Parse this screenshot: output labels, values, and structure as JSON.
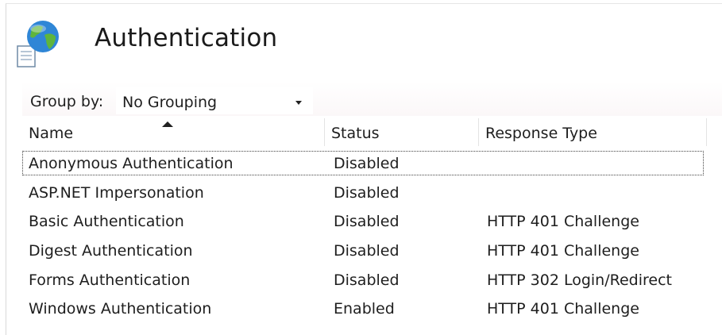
{
  "header": {
    "title": "Authentication",
    "icon": "authentication-feature-icon"
  },
  "toolbar": {
    "group_by_label": "Group by:",
    "group_by_value": "No Grouping"
  },
  "grid": {
    "columns": [
      {
        "label": "Name",
        "sorted": "ascending"
      },
      {
        "label": "Status"
      },
      {
        "label": "Response Type"
      }
    ],
    "rows": [
      {
        "name": "Anonymous Authentication",
        "status": "Disabled",
        "response": ""
      },
      {
        "name": "ASP.NET Impersonation",
        "status": "Disabled",
        "response": ""
      },
      {
        "name": "Basic Authentication",
        "status": "Disabled",
        "response": "HTTP 401 Challenge"
      },
      {
        "name": "Digest Authentication",
        "status": "Disabled",
        "response": "HTTP 401 Challenge"
      },
      {
        "name": "Forms Authentication",
        "status": "Disabled",
        "response": "HTTP 302 Login/Redirect"
      },
      {
        "name": "Windows Authentication",
        "status": "Enabled",
        "response": "HTTP 401 Challenge"
      }
    ],
    "selected_row": 0
  },
  "colors": {
    "text": "#1e1e1e",
    "header_border": "#e3e3e3",
    "globe_blue": "#2f86d6",
    "globe_green": "#5fb53c"
  }
}
